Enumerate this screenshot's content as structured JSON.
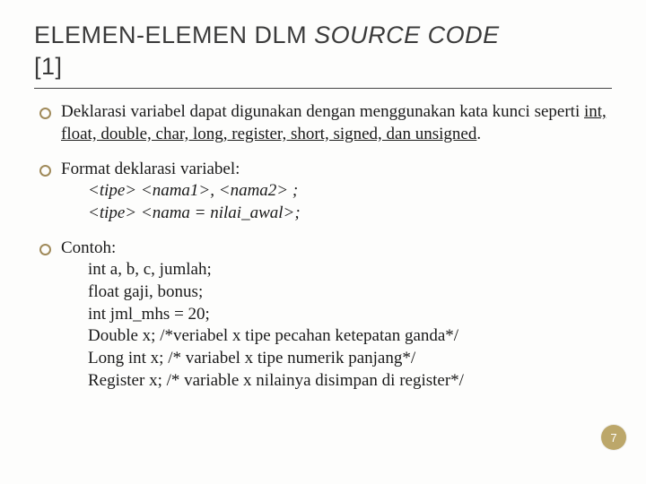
{
  "title": {
    "part1": "ELEMEN-ELEMEN DLM ",
    "italic": "SOURCE CODE",
    "part2": " [1]"
  },
  "bullets": {
    "b1": "Deklarasi variabel dapat digunakan dengan menggunakan kata kunci seperti ",
    "b1_keywords": "int, float, double, char, long, register, short, signed, dan unsigned",
    "b1_end": ".",
    "b2": "Format deklarasi variabel:",
    "b2_sub1": "<tipe> <nama1>, <nama2> ;",
    "b2_sub2": "<tipe> <nama = nilai_awal>;",
    "b3": "Contoh:",
    "b3_sub1": "int a, b, c, jumlah;",
    "b3_sub2": "float gaji, bonus;",
    "b3_sub3": "int jml_mhs = 20;",
    "b3_sub4": "Double x; /*veriabel x tipe pecahan ketepatan ganda*/",
    "b3_sub5": "Long int x; /* variabel x tipe numerik panjang*/",
    "b3_sub6": "Register x; /* variable x nilainya disimpan di register*/"
  },
  "page_number": "7"
}
